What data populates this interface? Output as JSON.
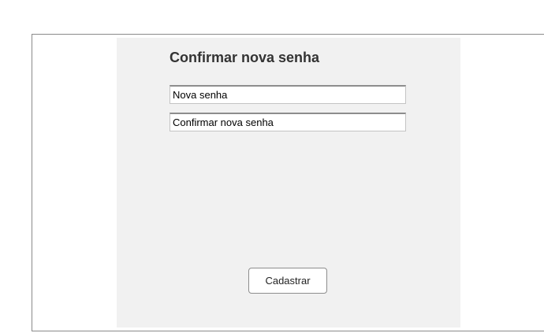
{
  "form": {
    "title": "Confirmar nova senha",
    "new_password_field": {
      "value": "Nova senha"
    },
    "confirm_password_field": {
      "value": "Confirmar nova senha"
    },
    "submit_label": "Cadastrar"
  }
}
